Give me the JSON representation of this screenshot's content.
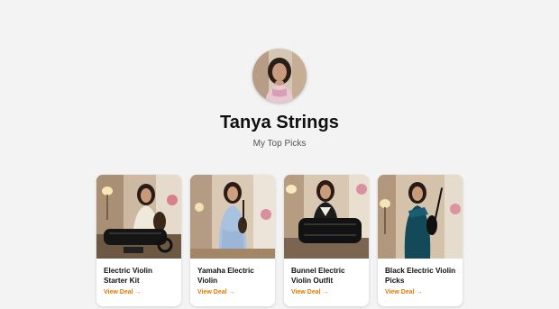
{
  "profile": {
    "name": "Tanya Strings",
    "subtitle": "My Top Picks",
    "avatar_icon": "profile-photo"
  },
  "cards": [
    {
      "title": "Electric Violin Starter Kit",
      "link_label": "View Deal →",
      "image_icon": "violin-starter-kit-photo"
    },
    {
      "title": "Yamaha Electric Violin",
      "link_label": "View Deal →",
      "image_icon": "yamaha-violin-photo"
    },
    {
      "title": "Bunnel Electric Violin Outfit",
      "link_label": "View Deal →",
      "image_icon": "bunnel-violin-outfit-photo"
    },
    {
      "title": "Black Electric Violin Picks",
      "link_label": "View Deal →",
      "image_icon": "black-violin-photo"
    }
  ],
  "colors": {
    "background": "#f3f3f3",
    "accent": "#e07b00",
    "card": "#ffffff"
  }
}
